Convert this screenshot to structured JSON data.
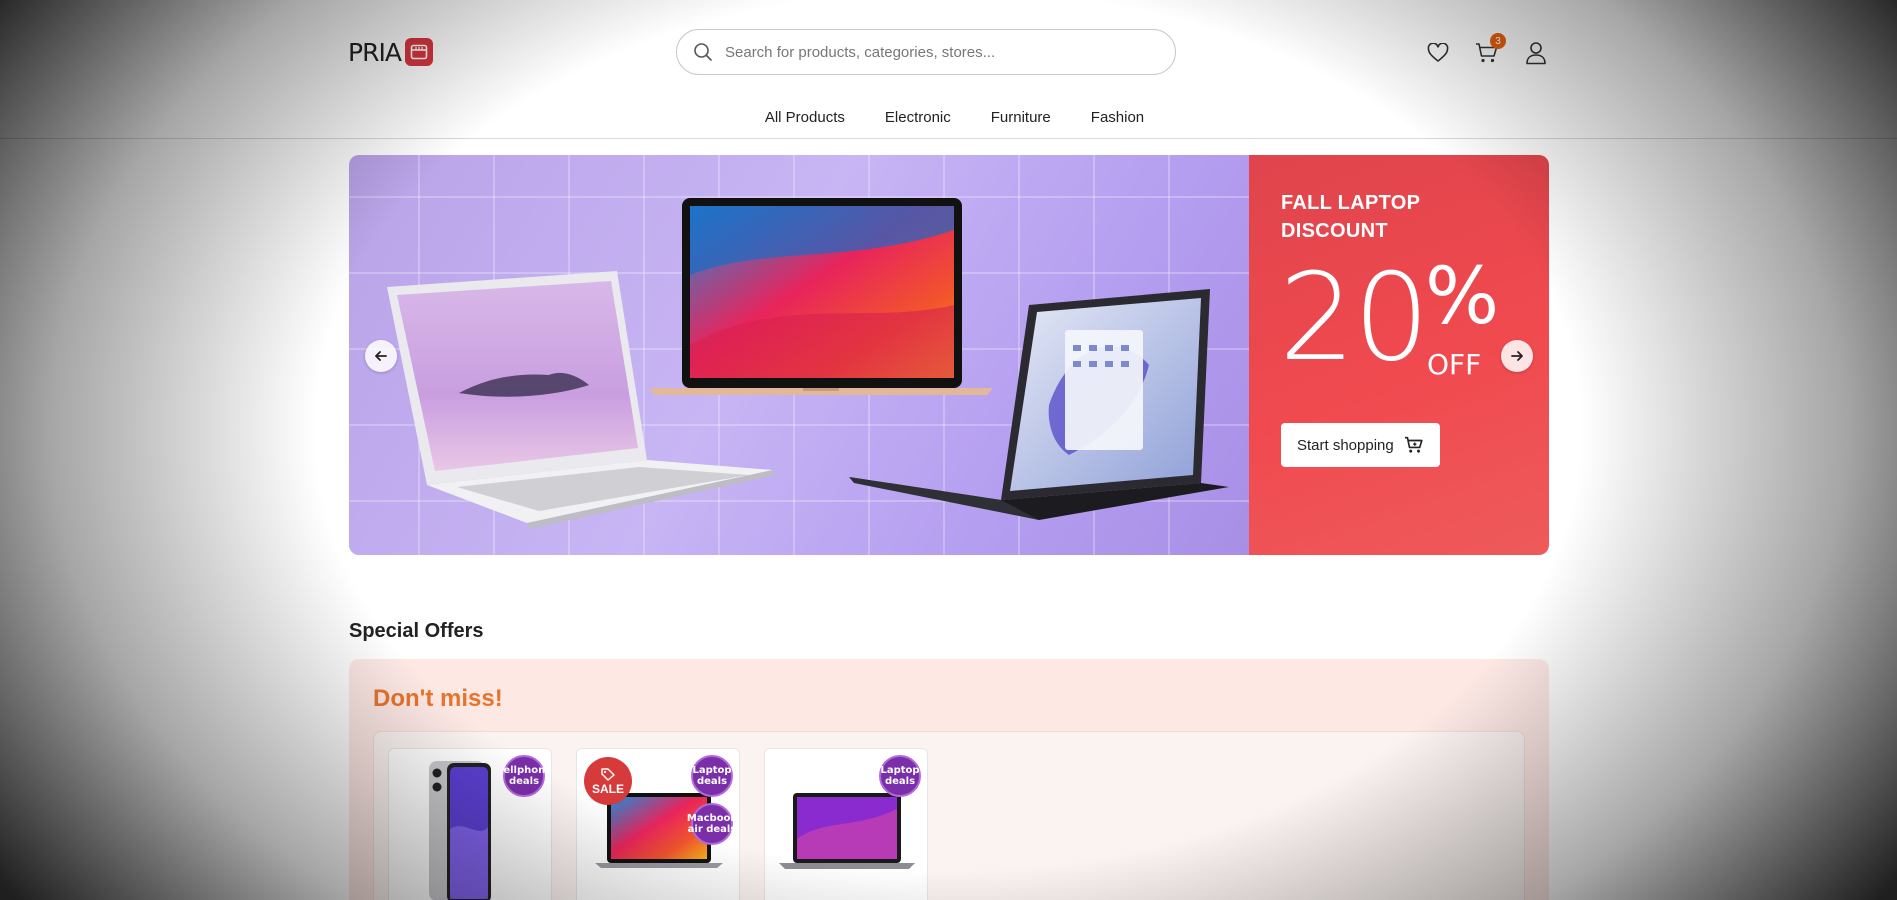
{
  "header": {
    "logo_text": "PRIA",
    "search": {
      "placeholder": "Search for products, categories, stores..."
    },
    "cart_count": "3",
    "icons": {
      "wishlist": "heart-icon",
      "cart": "cart-icon",
      "account": "user-icon"
    }
  },
  "nav": {
    "items": [
      {
        "label": "All Products"
      },
      {
        "label": "Electronic"
      },
      {
        "label": "Furniture"
      },
      {
        "label": "Fashion"
      }
    ]
  },
  "banner": {
    "title": "FALL LAPTOP DISCOUNT",
    "discount_number": "20",
    "percent_sign": "%",
    "off_label": "OFF",
    "button_label": "Start shopping",
    "colors": {
      "promo": "#ee4b50",
      "photo_bg": "#c2adf0"
    }
  },
  "special_offers": {
    "title": "Special Offers",
    "subtitle": "Don't miss!",
    "cards": [
      {
        "image": "phone",
        "tags": [
          "Cellphone deals"
        ]
      },
      {
        "image": "laptop",
        "sale_label": "SALE",
        "tags": [
          "Laptop deals",
          "Macbook air deals"
        ]
      },
      {
        "image": "macbook",
        "tags": [
          "Laptop deals"
        ]
      }
    ]
  }
}
